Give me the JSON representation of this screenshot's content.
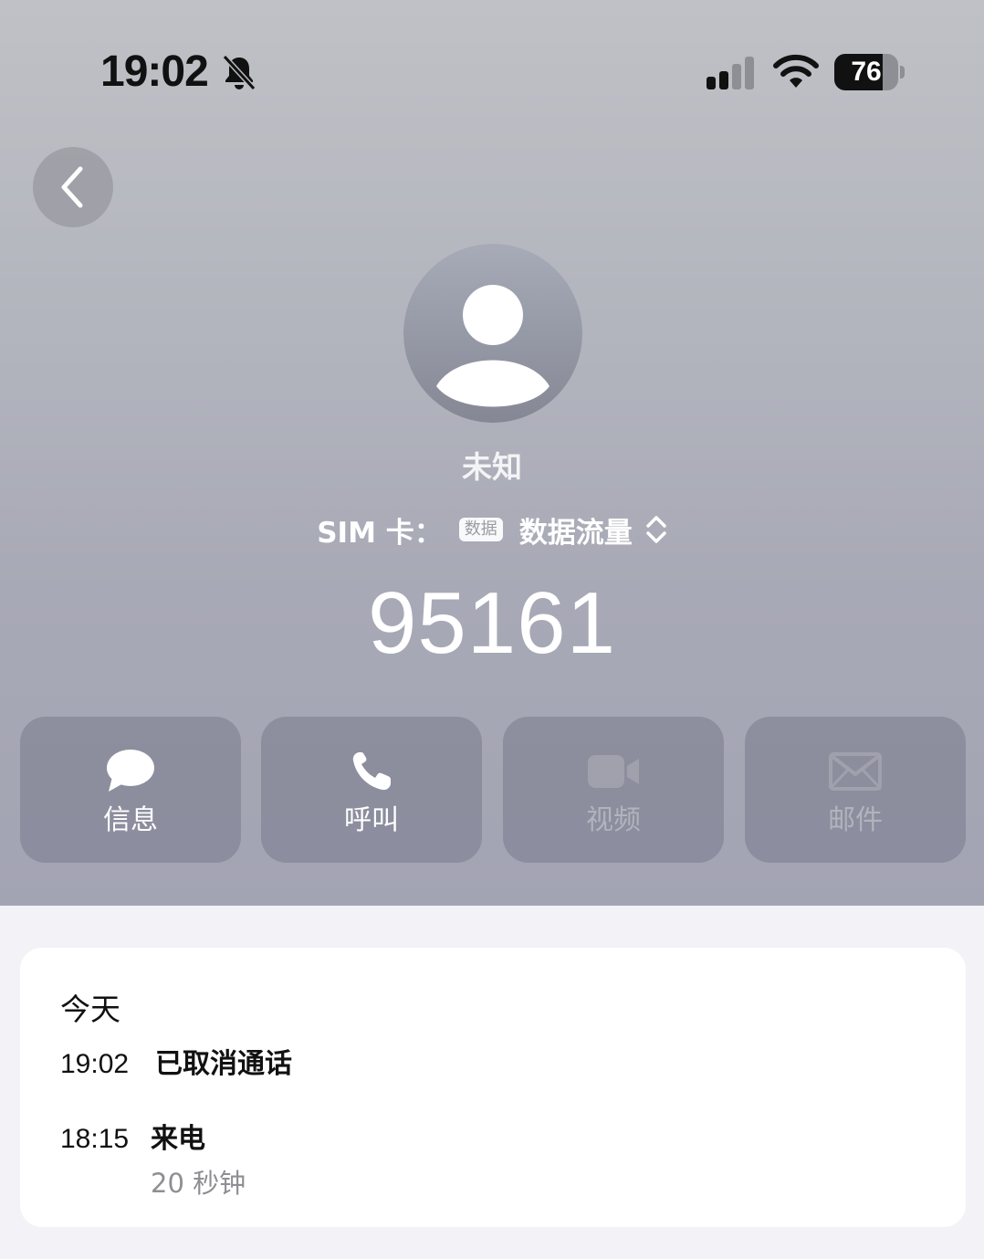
{
  "status_bar": {
    "time": "19:02",
    "battery_level": "76",
    "battery_fraction": 0.76,
    "icons": [
      "bell-slash-icon",
      "signal-icon",
      "wifi-icon",
      "battery-icon"
    ]
  },
  "navigation": {
    "back_icon": "chevron-left-icon"
  },
  "contact": {
    "avatar_icon": "person-silhouette-icon",
    "name": "未知",
    "sim_label": "SIM 卡：",
    "sim_tag": "数据",
    "sim_value": "数据流量",
    "sim_selector_icon": "chevron-up-down-icon",
    "number": "95161"
  },
  "actions": [
    {
      "label": "信息",
      "icon": "message-bubble-icon",
      "enabled": true
    },
    {
      "label": "呼叫",
      "icon": "phone-icon",
      "enabled": true
    },
    {
      "label": "视频",
      "icon": "video-camera-icon",
      "enabled": false
    },
    {
      "label": "邮件",
      "icon": "envelope-icon",
      "enabled": false
    }
  ],
  "history": {
    "day": "今天",
    "entries": [
      {
        "time": "19:02",
        "status": "已取消通话",
        "duration": ""
      },
      {
        "time": "18:15",
        "status": "来电",
        "duration": "20 秒钟"
      }
    ]
  },
  "colors": {
    "header_gradient_top": "#c0c1c6",
    "header_gradient_bottom": "#a3a4b3",
    "disabled_label": "#b2b3bd",
    "secondary_text": "#8e8e93"
  }
}
